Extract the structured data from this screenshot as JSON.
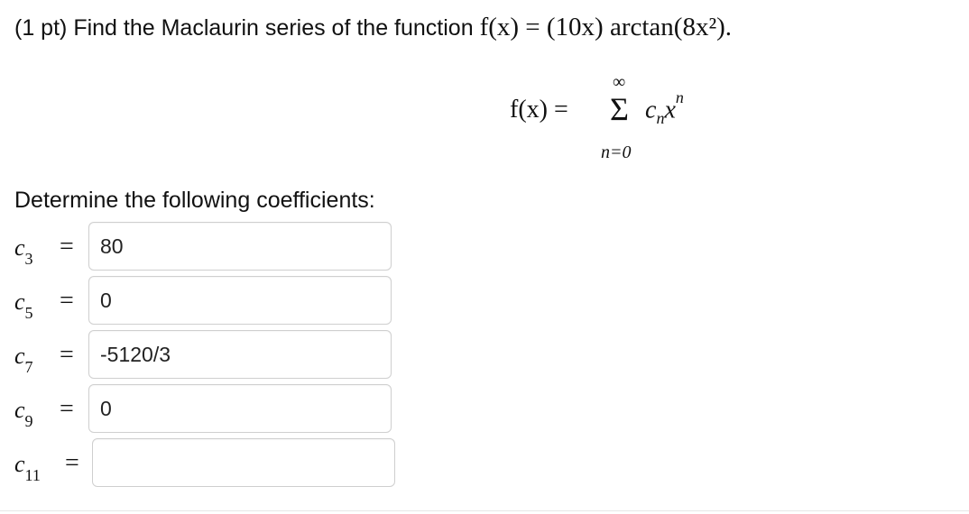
{
  "prompt": {
    "points": "(1 pt)",
    "text": "Find the Maclaurin series of the function",
    "function_expression": "f(x) = (10x) arctan(8x²)."
  },
  "series": {
    "lhs": "f(x) =",
    "upper_limit": "∞",
    "sigma": "Σ",
    "term_coef": "c",
    "term_coef_sub": "n",
    "term_var": "x",
    "term_exp": "n",
    "lower_limit": "n=0"
  },
  "instruction": "Determine the following coefficients:",
  "coefficients": [
    {
      "name": "c",
      "index": "3",
      "equals": "=",
      "value": "80"
    },
    {
      "name": "c",
      "index": "5",
      "equals": "=",
      "value": "0"
    },
    {
      "name": "c",
      "index": "7",
      "equals": "=",
      "value": "-5120/3"
    },
    {
      "name": "c",
      "index": "9",
      "equals": "=",
      "value": "0"
    },
    {
      "name": "c",
      "index": "11",
      "equals": "=",
      "value": ""
    }
  ]
}
